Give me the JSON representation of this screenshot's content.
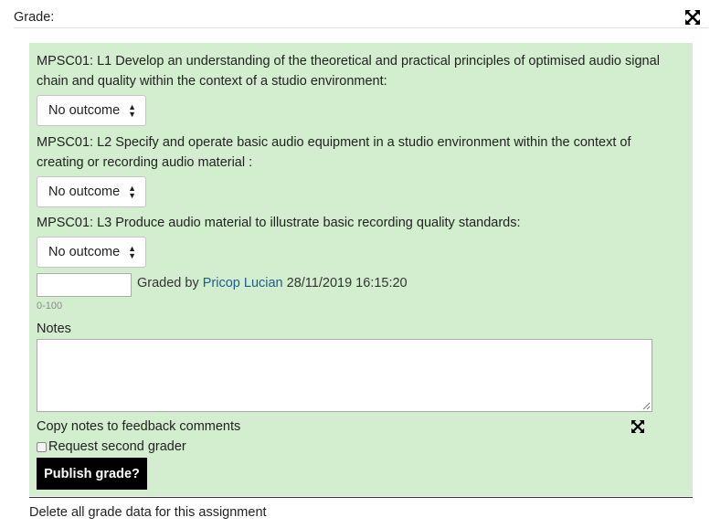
{
  "header": {
    "label": "Grade:"
  },
  "outcomes": [
    {
      "text": "MPSC01: L1 Develop an understanding of the theoretical and practical principles of optimised audio signal chain and quality within the context of a studio environment:",
      "selected": "No outcome"
    },
    {
      "text": "MPSC01: L2 Specify and operate basic audio equipment in a studio environment within the context of creating or recording audio material :",
      "selected": "No outcome"
    },
    {
      "text": "MPSC01: L3 Produce audio material to illustrate basic recording quality standards:",
      "selected": "No outcome"
    }
  ],
  "grade": {
    "value": "",
    "graded_by_prefix": "Graded by",
    "grader": "Pricop Lucian",
    "timestamp": "28/11/2019 16:15:20",
    "range_hint": "0-100"
  },
  "notes": {
    "label": "Notes",
    "value": ""
  },
  "copy_notes_label": "Copy notes to feedback comments",
  "second_grader_label": "Request second grader",
  "publish_label": "Publish grade?",
  "delete_label": "Delete all grade data for this assignment",
  "colors": {
    "panel_bg": "#d3eecf",
    "link": "#1f5c8f",
    "button_bg": "#000000"
  },
  "icons": {
    "expand": "expand-arrows-icon",
    "select_arrows": "updown-caret-icon"
  }
}
